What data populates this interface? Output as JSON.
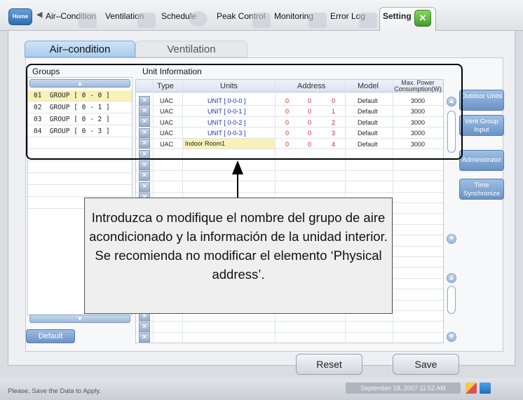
{
  "nav": {
    "home_label": "Home",
    "tabs": [
      "Air–Condition",
      "Ventilation",
      "Schedule",
      "Peak Control",
      "Monitoring",
      "Error Log",
      "Setting"
    ],
    "active_tab": "Setting"
  },
  "subtabs": {
    "air": "Air–condition",
    "vent": "Ventilation"
  },
  "groups": {
    "title": "Groups",
    "items": [
      "01  GROUP [ 0 - 0 ]",
      "02  GROUP [ 0 - 1 ]",
      "03  GROUP [ 0 - 2 ]",
      "04  GROUP [ 0 - 3 ]"
    ],
    "default_label": "Default"
  },
  "units": {
    "title": "Unit Information",
    "headers": {
      "type": "Type",
      "units": "Units",
      "address": "Address",
      "model": "Model",
      "maxpower": "Max. Power Consumption(W)"
    },
    "rows": [
      {
        "type": "UAC",
        "unit": "UNIT [ 0-0-0 ]",
        "a1": "0",
        "a2": "0",
        "a3": "0",
        "model": "Default",
        "power": "3000"
      },
      {
        "type": "UAC",
        "unit": "UNIT [ 0-0-1 ]",
        "a1": "0",
        "a2": "0",
        "a3": "1",
        "model": "Default",
        "power": "3000"
      },
      {
        "type": "UAC",
        "unit": "UNIT [ 0-0-2 ]",
        "a1": "0",
        "a2": "0",
        "a3": "2",
        "model": "Default",
        "power": "3000"
      },
      {
        "type": "UAC",
        "unit": "UNIT [ 0-0-3 ]",
        "a1": "0",
        "a2": "0",
        "a3": "3",
        "model": "Default",
        "power": "3000"
      },
      {
        "type": "UAC",
        "unit": "Indoor Room1",
        "a1": "0",
        "a2": "0",
        "a3": "4",
        "model": "Default",
        "power": "3000"
      }
    ]
  },
  "side_buttons": {
    "outdoor": "Outdoor Units",
    "ventgroup": "Vent Group Input",
    "admin": "Administrator",
    "time": "Time Synchronize"
  },
  "callout": "Introduzca o modifique el nombre del grupo de aire acondicionado y la información de la unidad interior. Se recomienda no modificar el elemento ‘Physical address’.",
  "buttons": {
    "reset": "Reset",
    "save": "Save"
  },
  "status": {
    "message": "Please, Save the Data to Apply.",
    "datetime": "September 18, 2007 11:52 AM"
  }
}
